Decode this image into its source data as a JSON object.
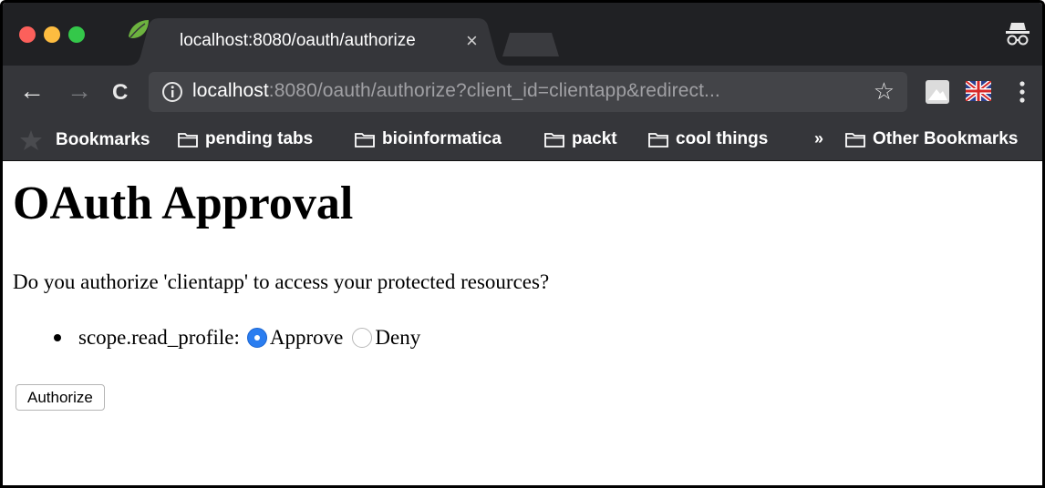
{
  "window": {
    "traffic_lights": [
      "#fc605b",
      "#fdbc40",
      "#34c84a"
    ]
  },
  "tab": {
    "title": "localhost:8080/oauth/authorize",
    "close_glyph": "×",
    "favicon": "spring-leaf-icon"
  },
  "toolbar": {
    "back_glyph": "←",
    "forward_glyph": "→",
    "reload_glyph": "C",
    "url_host": "localhost",
    "url_rest": ":8080/oauth/authorize?client_id=clientapp&redirect...",
    "star_glyph": "☆",
    "menu_glyph": "⋮"
  },
  "bookmarks": {
    "bookmarks_label": "Bookmarks",
    "items": [
      "pending tabs",
      "bioinformatica",
      "packt",
      "cool things"
    ],
    "overflow_glyph": "»",
    "other_label": "Other Bookmarks"
  },
  "page": {
    "heading": "OAuth Approval",
    "question": "Do you authorize 'clientapp' to access your protected resources?",
    "scope_label": "scope.read_profile:",
    "approve_label": "Approve",
    "deny_label": "Deny",
    "approve_selected": true,
    "authorize_button": "Authorize"
  },
  "colors": {
    "tabstrip": "#202124",
    "toolbar": "#35363a",
    "omnibox": "#434448",
    "radio_selected": "#2a7df0"
  }
}
